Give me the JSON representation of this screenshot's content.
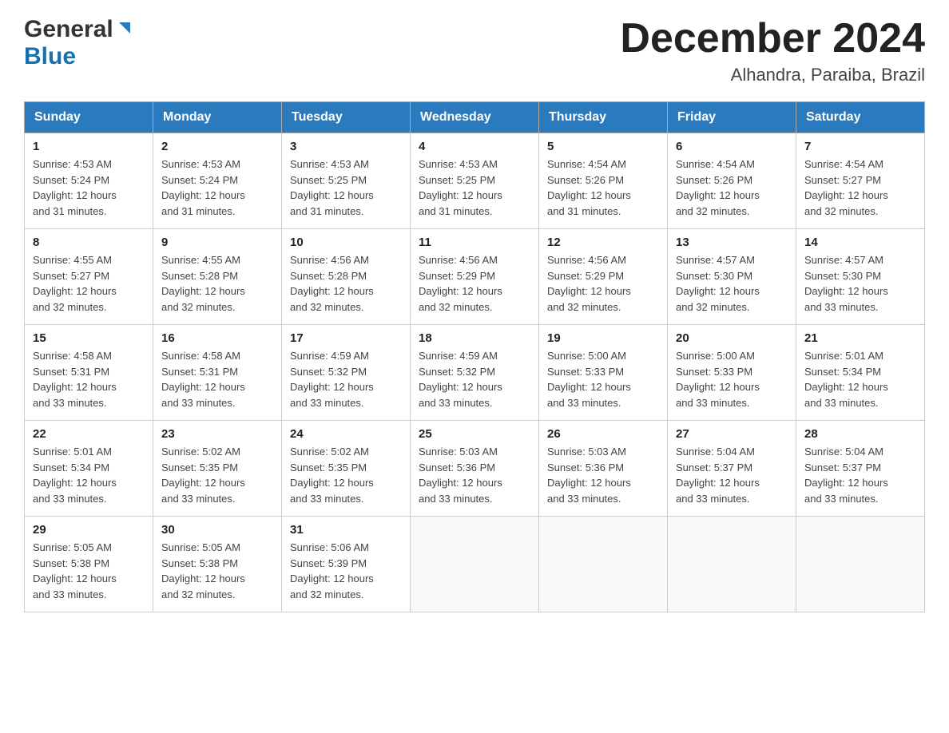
{
  "header": {
    "logo_general": "General",
    "logo_blue": "Blue",
    "title": "December 2024",
    "subtitle": "Alhandra, Paraiba, Brazil"
  },
  "calendar": {
    "weekdays": [
      "Sunday",
      "Monday",
      "Tuesday",
      "Wednesday",
      "Thursday",
      "Friday",
      "Saturday"
    ],
    "weeks": [
      [
        {
          "day": "1",
          "sunrise": "4:53 AM",
          "sunset": "5:24 PM",
          "daylight": "12 hours and 31 minutes."
        },
        {
          "day": "2",
          "sunrise": "4:53 AM",
          "sunset": "5:24 PM",
          "daylight": "12 hours and 31 minutes."
        },
        {
          "day": "3",
          "sunrise": "4:53 AM",
          "sunset": "5:25 PM",
          "daylight": "12 hours and 31 minutes."
        },
        {
          "day": "4",
          "sunrise": "4:53 AM",
          "sunset": "5:25 PM",
          "daylight": "12 hours and 31 minutes."
        },
        {
          "day": "5",
          "sunrise": "4:54 AM",
          "sunset": "5:26 PM",
          "daylight": "12 hours and 31 minutes."
        },
        {
          "day": "6",
          "sunrise": "4:54 AM",
          "sunset": "5:26 PM",
          "daylight": "12 hours and 32 minutes."
        },
        {
          "day": "7",
          "sunrise": "4:54 AM",
          "sunset": "5:27 PM",
          "daylight": "12 hours and 32 minutes."
        }
      ],
      [
        {
          "day": "8",
          "sunrise": "4:55 AM",
          "sunset": "5:27 PM",
          "daylight": "12 hours and 32 minutes."
        },
        {
          "day": "9",
          "sunrise": "4:55 AM",
          "sunset": "5:28 PM",
          "daylight": "12 hours and 32 minutes."
        },
        {
          "day": "10",
          "sunrise": "4:56 AM",
          "sunset": "5:28 PM",
          "daylight": "12 hours and 32 minutes."
        },
        {
          "day": "11",
          "sunrise": "4:56 AM",
          "sunset": "5:29 PM",
          "daylight": "12 hours and 32 minutes."
        },
        {
          "day": "12",
          "sunrise": "4:56 AM",
          "sunset": "5:29 PM",
          "daylight": "12 hours and 32 minutes."
        },
        {
          "day": "13",
          "sunrise": "4:57 AM",
          "sunset": "5:30 PM",
          "daylight": "12 hours and 32 minutes."
        },
        {
          "day": "14",
          "sunrise": "4:57 AM",
          "sunset": "5:30 PM",
          "daylight": "12 hours and 33 minutes."
        }
      ],
      [
        {
          "day": "15",
          "sunrise": "4:58 AM",
          "sunset": "5:31 PM",
          "daylight": "12 hours and 33 minutes."
        },
        {
          "day": "16",
          "sunrise": "4:58 AM",
          "sunset": "5:31 PM",
          "daylight": "12 hours and 33 minutes."
        },
        {
          "day": "17",
          "sunrise": "4:59 AM",
          "sunset": "5:32 PM",
          "daylight": "12 hours and 33 minutes."
        },
        {
          "day": "18",
          "sunrise": "4:59 AM",
          "sunset": "5:32 PM",
          "daylight": "12 hours and 33 minutes."
        },
        {
          "day": "19",
          "sunrise": "5:00 AM",
          "sunset": "5:33 PM",
          "daylight": "12 hours and 33 minutes."
        },
        {
          "day": "20",
          "sunrise": "5:00 AM",
          "sunset": "5:33 PM",
          "daylight": "12 hours and 33 minutes."
        },
        {
          "day": "21",
          "sunrise": "5:01 AM",
          "sunset": "5:34 PM",
          "daylight": "12 hours and 33 minutes."
        }
      ],
      [
        {
          "day": "22",
          "sunrise": "5:01 AM",
          "sunset": "5:34 PM",
          "daylight": "12 hours and 33 minutes."
        },
        {
          "day": "23",
          "sunrise": "5:02 AM",
          "sunset": "5:35 PM",
          "daylight": "12 hours and 33 minutes."
        },
        {
          "day": "24",
          "sunrise": "5:02 AM",
          "sunset": "5:35 PM",
          "daylight": "12 hours and 33 minutes."
        },
        {
          "day": "25",
          "sunrise": "5:03 AM",
          "sunset": "5:36 PM",
          "daylight": "12 hours and 33 minutes."
        },
        {
          "day": "26",
          "sunrise": "5:03 AM",
          "sunset": "5:36 PM",
          "daylight": "12 hours and 33 minutes."
        },
        {
          "day": "27",
          "sunrise": "5:04 AM",
          "sunset": "5:37 PM",
          "daylight": "12 hours and 33 minutes."
        },
        {
          "day": "28",
          "sunrise": "5:04 AM",
          "sunset": "5:37 PM",
          "daylight": "12 hours and 33 minutes."
        }
      ],
      [
        {
          "day": "29",
          "sunrise": "5:05 AM",
          "sunset": "5:38 PM",
          "daylight": "12 hours and 33 minutes."
        },
        {
          "day": "30",
          "sunrise": "5:05 AM",
          "sunset": "5:38 PM",
          "daylight": "12 hours and 32 minutes."
        },
        {
          "day": "31",
          "sunrise": "5:06 AM",
          "sunset": "5:39 PM",
          "daylight": "12 hours and 32 minutes."
        },
        null,
        null,
        null,
        null
      ]
    ],
    "sunrise_label": "Sunrise:",
    "sunset_label": "Sunset:",
    "daylight_label": "Daylight:"
  }
}
